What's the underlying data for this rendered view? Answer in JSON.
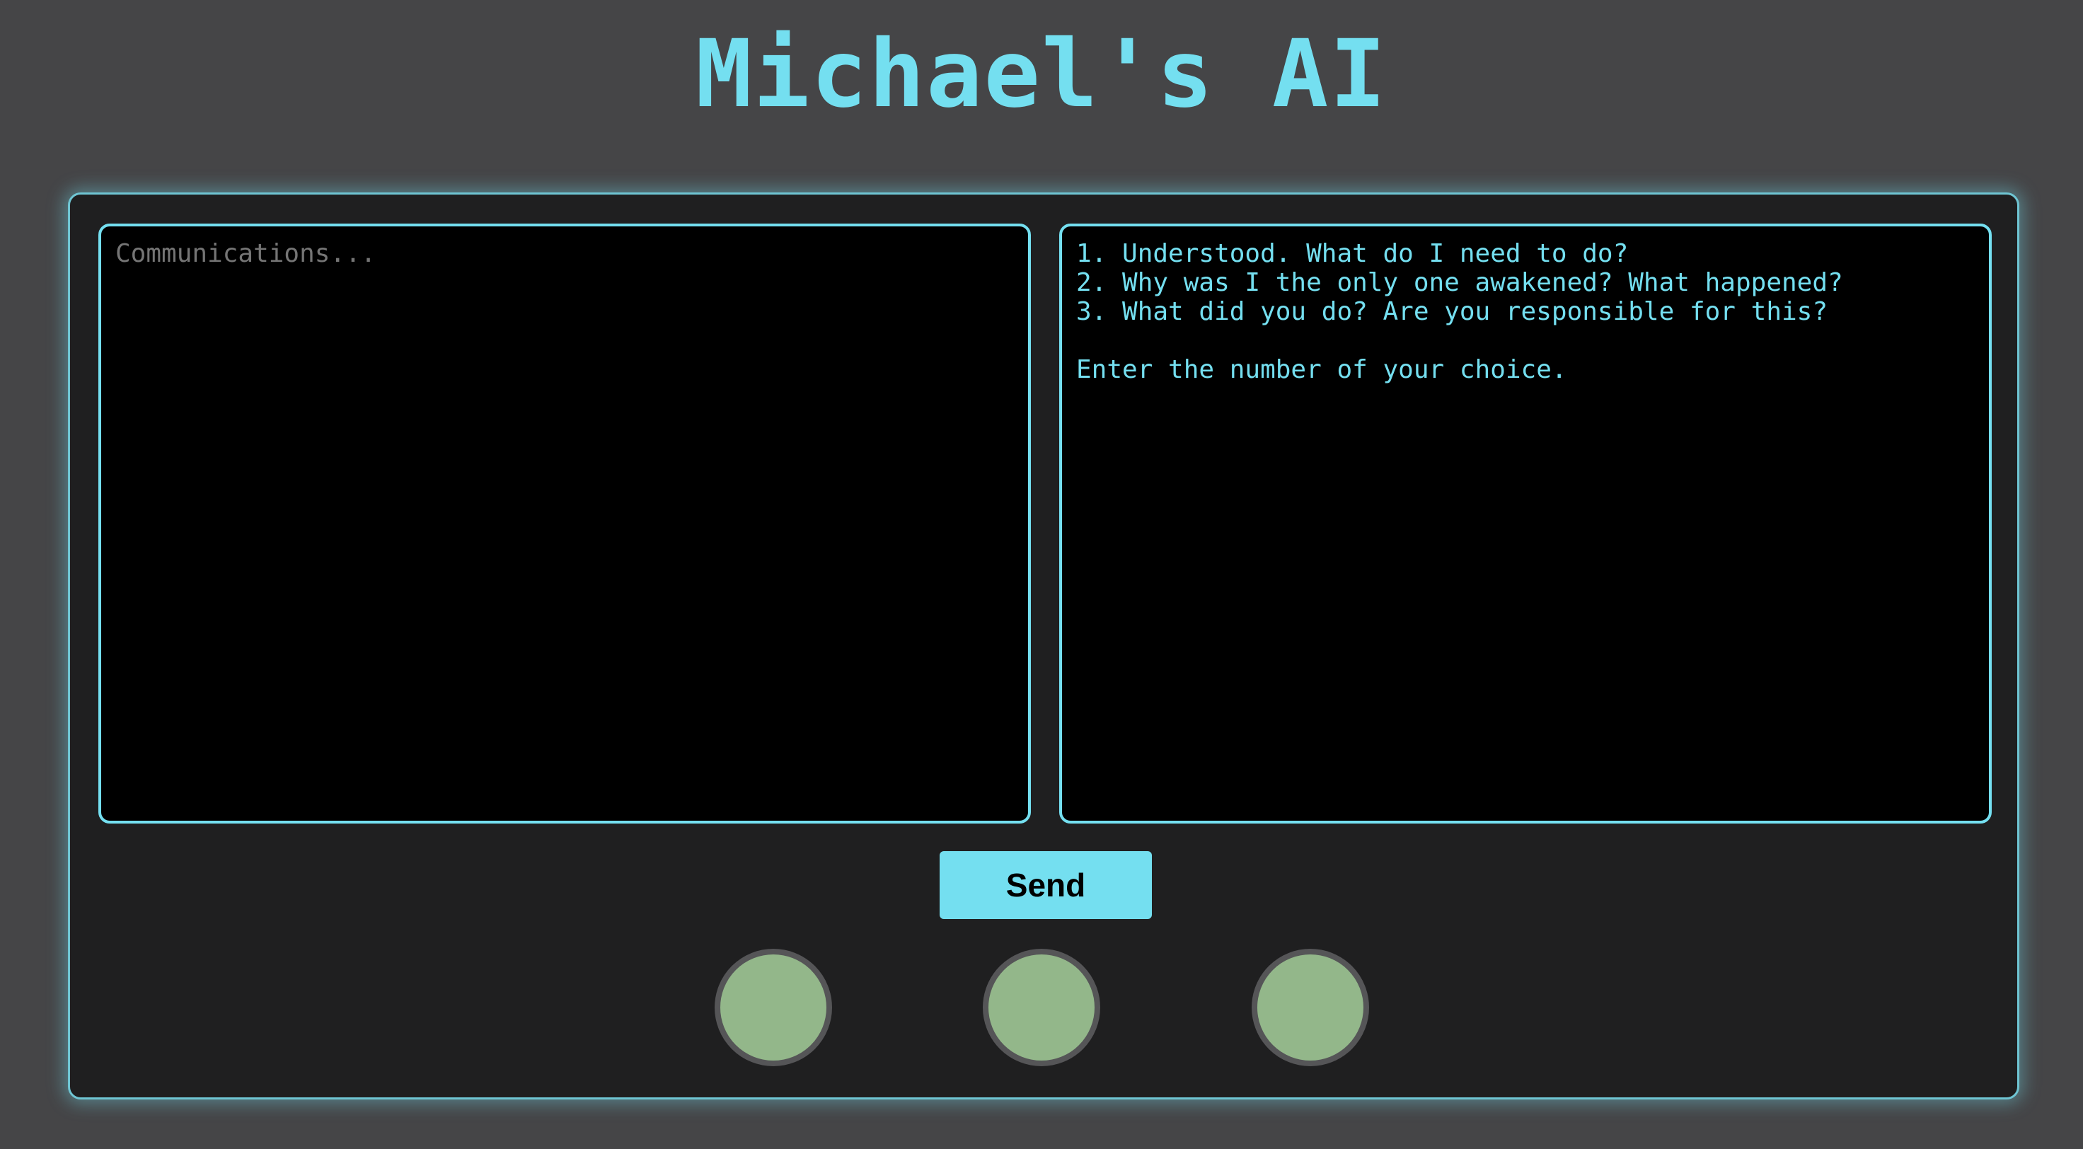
{
  "header": {
    "title": "Michael's AI"
  },
  "console": {
    "input": {
      "placeholder": "Communications...",
      "value": ""
    },
    "output": {
      "lines": [
        "1. Understood. What do I need to do?",
        "2. Why was I the only one awakened? What happened?",
        "3. What did you do? Are you responsible for this?",
        "",
        "Enter the number of your choice."
      ]
    },
    "send_label": "Send",
    "indicators": [
      {
        "status": "active",
        "color": "#93b78a"
      },
      {
        "status": "active",
        "color": "#93b78a"
      },
      {
        "status": "active",
        "color": "#93b78a"
      }
    ]
  },
  "colors": {
    "accent": "#74dff0",
    "page_background": "#454547",
    "panel_background": "#1f1f20",
    "indicator_fill": "#93b78a",
    "indicator_border": "#555557"
  }
}
